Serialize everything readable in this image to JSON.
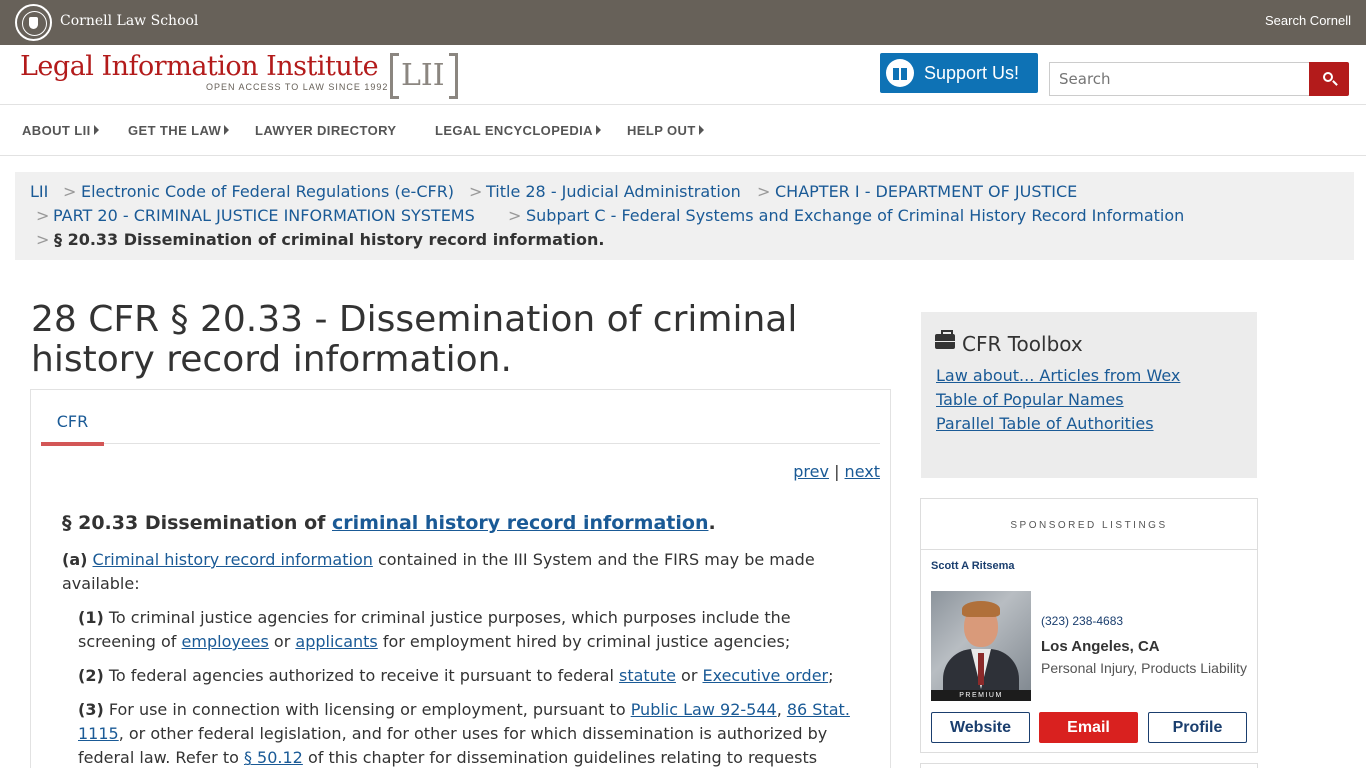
{
  "top_bar": {
    "org_name": "Cornell Law School",
    "search_link": "Search Cornell"
  },
  "header": {
    "logo_text": "Legal Information Institute",
    "logo_tagline": "OPEN ACCESS TO LAW SINCE 1992",
    "logo_mark": "LII",
    "support_label": "Support Us!",
    "search_placeholder": "Search"
  },
  "nav": {
    "items": [
      {
        "label": "ABOUT LII",
        "has_caret": true
      },
      {
        "label": "GET THE LAW",
        "has_caret": true
      },
      {
        "label": "LAWYER DIRECTORY",
        "has_caret": false
      },
      {
        "label": "LEGAL ENCYCLOPEDIA",
        "has_caret": true
      },
      {
        "label": "HELP OUT",
        "has_caret": true
      }
    ]
  },
  "breadcrumb": {
    "sep": ">",
    "items": [
      "LII",
      "Electronic Code of Federal Regulations (e-CFR)",
      "Title 28 - Judicial Administration",
      "CHAPTER I - DEPARTMENT OF JUSTICE",
      "PART 20 - CRIMINAL JUSTICE INFORMATION SYSTEMS",
      "Subpart C - Federal Systems and Exchange of Criminal History Record Information"
    ],
    "current": "§ 20.33 Dissemination of criminal history record information."
  },
  "main": {
    "title": "28 CFR § 20.33 - Dissemination of criminal history record information.",
    "tab_label": "CFR",
    "prev": "prev",
    "next": "next",
    "pn_sep": "|",
    "section": {
      "heading_prefix": "§ 20.33 Dissemination of ",
      "heading_link": "criminal history record information",
      "heading_suffix": "."
    },
    "para_a": {
      "num": "(a)",
      "link": "Criminal history record information",
      "text": " contained in the III System and the FIRS may be made available:"
    },
    "para_1": {
      "num": "(1)",
      "t1": " To criminal justice agencies for criminal justice purposes, which purposes include the screening of ",
      "link1": "employees",
      "t2": " or ",
      "link2": "applicants",
      "t3": " for employment hired by criminal justice agencies;"
    },
    "para_2": {
      "num": "(2)",
      "t1": " To federal agencies authorized to receive it pursuant to federal ",
      "link1": "statute",
      "t2": " or ",
      "link2": "Executive order",
      "t3": ";"
    },
    "para_3": {
      "num": "(3)",
      "t1": " For use in connection with licensing or employment, pursuant to ",
      "link1": "Public Law 92-544",
      "t2": ", ",
      "link2": "86 Stat. 1115",
      "t3": ", or other federal legislation, and for other uses for which dissemination is authorized by federal law. Refer to ",
      "link3": "§ 50.12",
      "t4": " of this chapter for dissemination guidelines relating to requests"
    }
  },
  "sidebar": {
    "toolbox_title": "CFR Toolbox",
    "toolbox_links": [
      "Law about... Articles from Wex",
      "Table of Popular Names",
      "Parallel Table of Authorities"
    ],
    "sponsored_heading": "SPONSORED LISTINGS",
    "listing": {
      "name": "Scott A Ritsema",
      "badge": "PREMIUM",
      "phone": "(323) 238-4683",
      "city": "Los Angeles, CA",
      "practice": "Personal Injury, Products Liability",
      "buttons": [
        "Website",
        "Email",
        "Profile"
      ]
    }
  },
  "colors": {
    "cornell_bar": "#676159",
    "brand_red": "#b31b1b",
    "link_blue": "#1a5a96",
    "support_blue": "#0e72b5",
    "email_red": "#d9211f"
  }
}
